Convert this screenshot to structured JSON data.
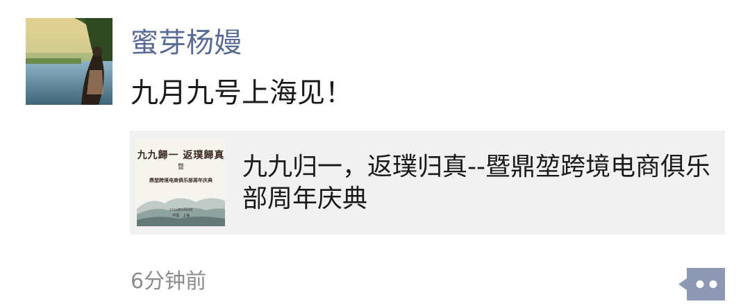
{
  "post": {
    "username": "蜜芽杨嫚",
    "text": "九月九号上海见！",
    "timestamp": "6分钟前"
  },
  "link_card": {
    "title": "九九归一，返璞归真--暨鼎堃跨境电商俱乐部周年庆典",
    "thumbnail": {
      "headline": "九九歸一 返璞歸真",
      "sub": "暨",
      "event": "鼎堃跨境电商俱乐部周年庆典",
      "footer_line1": "2018年9月9日",
      "footer_line2": "中国 · 上海"
    }
  },
  "icons": {
    "more": "more-dots-icon"
  },
  "colors": {
    "username": "#586b95",
    "text": "#1a1a1a",
    "card_bg": "#f1f1f1",
    "timestamp": "#8c8c8c",
    "more_btn": "#8c98b4"
  }
}
